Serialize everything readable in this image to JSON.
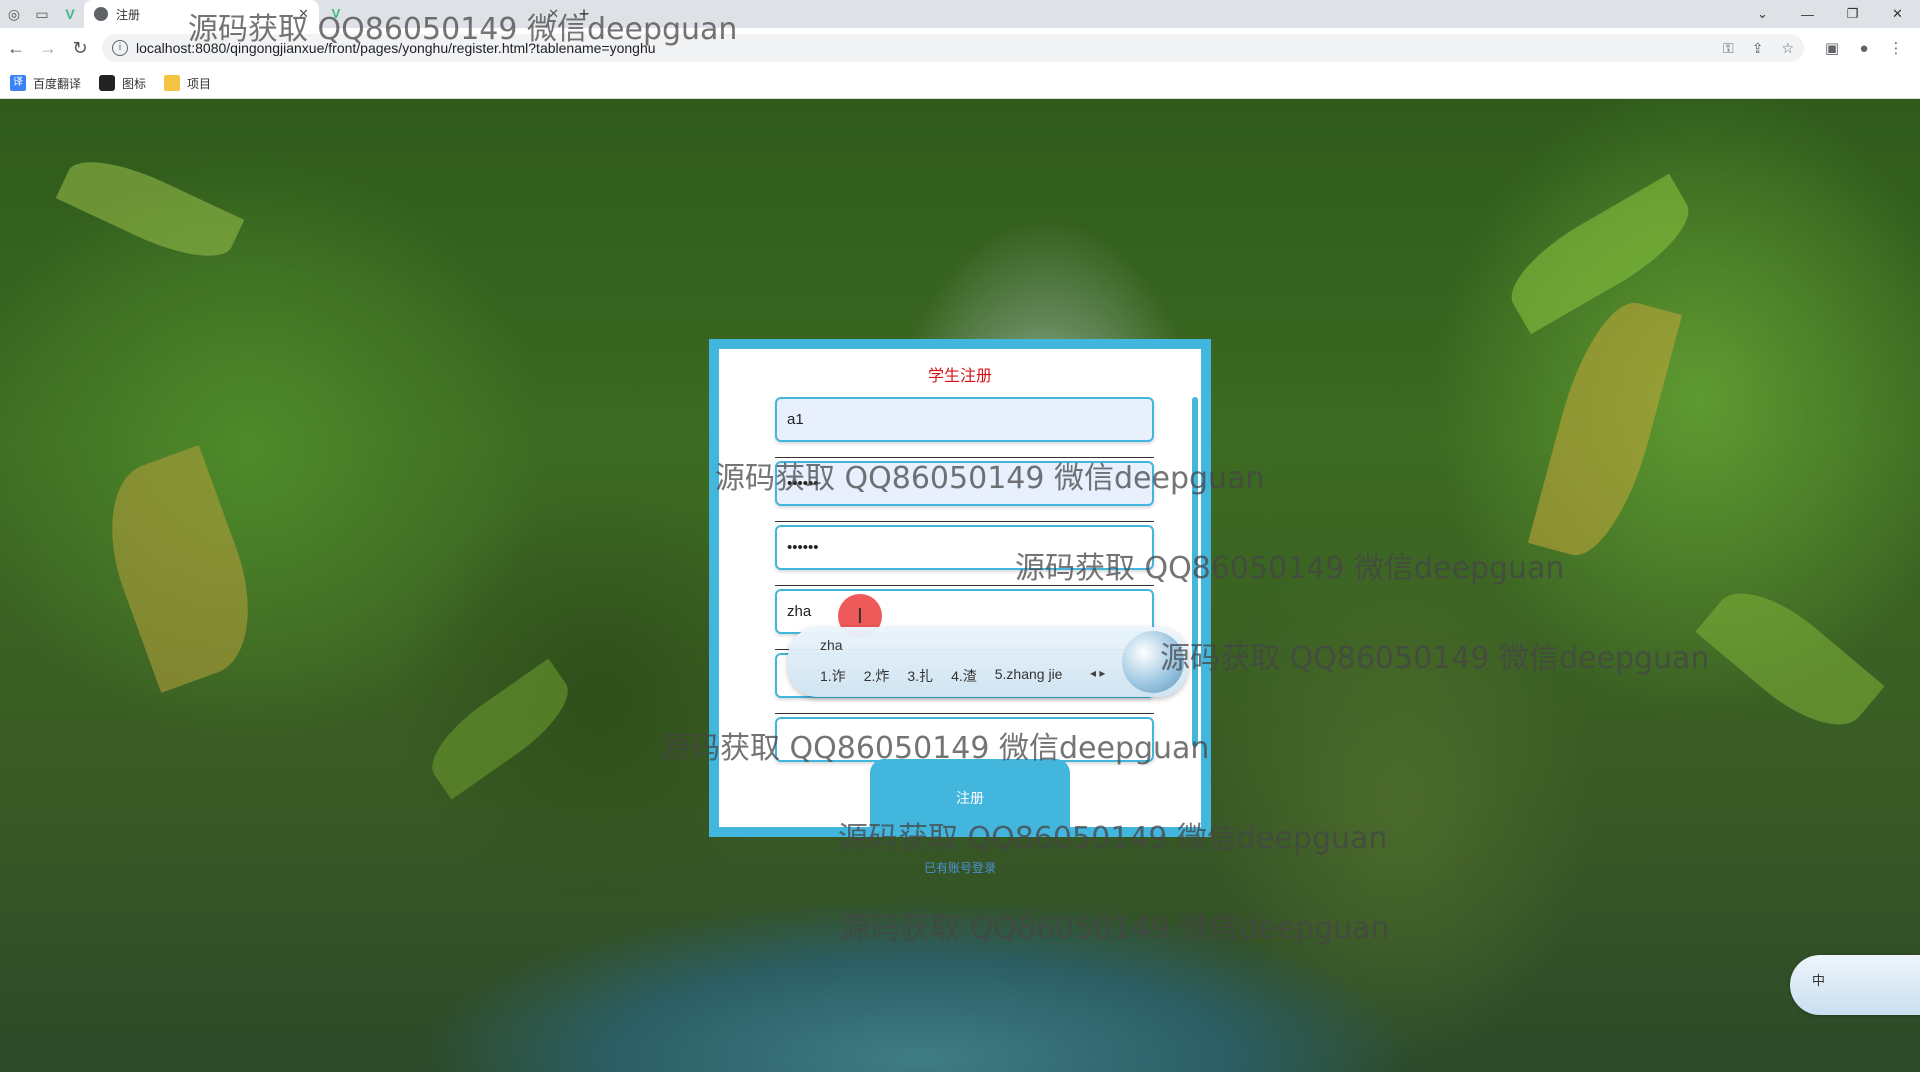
{
  "browser": {
    "tabs": [
      {
        "label": "注册",
        "active": true
      },
      {
        "label": "",
        "active": false
      }
    ],
    "url": "localhost:8080/qingongjianxue/front/pages/yonghu/register.html?tablename=yonghu",
    "bookmarks": [
      "百度翻译",
      "图标",
      "项目"
    ]
  },
  "form": {
    "title": "学生注册",
    "fields": [
      {
        "value": "a1",
        "type": "text"
      },
      {
        "value": "••••••",
        "type": "password"
      },
      {
        "value": "••••••",
        "type": "password"
      },
      {
        "value": "zha",
        "type": "text"
      },
      {
        "value": "",
        "type": "text"
      },
      {
        "value": "",
        "type": "text"
      }
    ],
    "submit_label": "注册",
    "login_link": "已有账号登录"
  },
  "ime": {
    "composition": "zha",
    "candidates": [
      "1.诈",
      "2.炸",
      "3.扎",
      "4.渣",
      "5.zhang jie"
    ],
    "status": "中"
  },
  "watermark": "源码获取 QQ86050149 微信deepguan",
  "colors": {
    "accent": "#43b6de",
    "title": "#d4141a"
  }
}
